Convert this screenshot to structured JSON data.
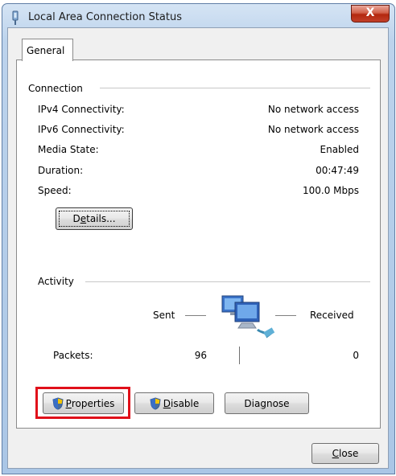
{
  "window": {
    "title": "Local Area Connection Status",
    "close_glyph": "X"
  },
  "tabs": [
    {
      "label": "General",
      "selected": true
    }
  ],
  "connection": {
    "group_title": "Connection",
    "rows": [
      {
        "label": "IPv4 Connectivity:",
        "value": "No network access"
      },
      {
        "label": "IPv6 Connectivity:",
        "value": "No network access"
      },
      {
        "label": "Media State:",
        "value": "Enabled"
      },
      {
        "label": "Duration:",
        "value": "00:47:49"
      },
      {
        "label": "Speed:",
        "value": "100.0 Mbps"
      }
    ],
    "details_button": {
      "pre": "D",
      "accel": "e",
      "post": "tails..."
    }
  },
  "activity": {
    "group_title": "Activity",
    "sent_label": "Sent",
    "received_label": "Received",
    "packets_label": "Packets:",
    "packets_sent": "96",
    "packets_received": "0",
    "icon": "network-computers-icon"
  },
  "buttons": {
    "properties": {
      "accel": "P",
      "rest": "roperties",
      "icon": "uac-shield-icon",
      "highlighted": true,
      "highlight_color": "#e0101a"
    },
    "disable": {
      "accel": "D",
      "rest": "isable",
      "icon": "uac-shield-icon"
    },
    "diagnose": {
      "pre": "Dia",
      "accel": "g",
      "post": "nose"
    },
    "close": {
      "accel": "C",
      "rest": "lose"
    }
  }
}
